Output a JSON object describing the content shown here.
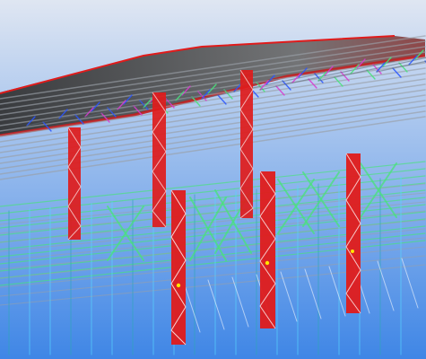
{
  "viewport": {
    "background_top": "#dfe6f2",
    "background_bottom": "#3f86e6"
  },
  "palette": {
    "column_red": "#e01b1b",
    "roof_deck": "#5a5a5a",
    "purlin_gray": "#9aa0a8",
    "brace_green": "#49e37b",
    "brace_blue": "#2a55ff",
    "brace_magenta": "#d93bd0",
    "girt_teal": "#2ea7b7",
    "girt_cyan": "#58d6ff",
    "white": "#ffffff",
    "yellow": "#ffe600"
  }
}
